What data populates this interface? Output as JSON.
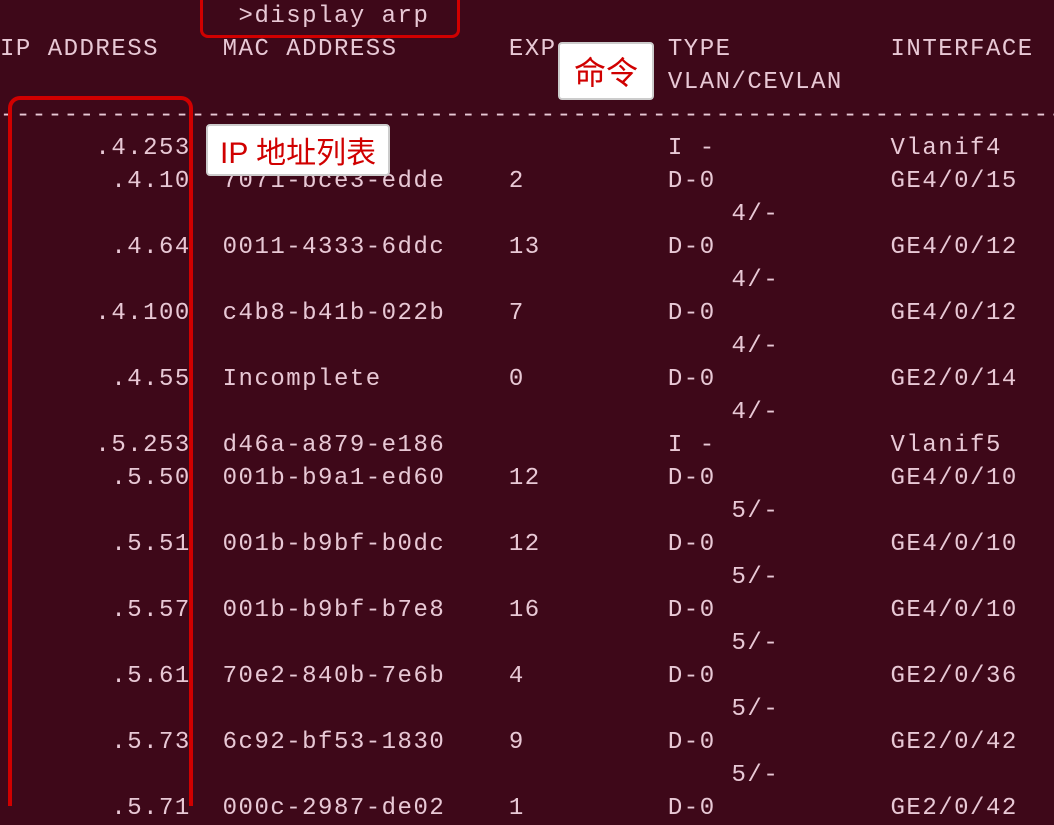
{
  "command": ">display arp",
  "headers": {
    "ip": "IP ADDRESS",
    "mac": "MAC ADDRESS",
    "exp": "EXP",
    "type": "TYPE",
    "iface": "INTERFACE",
    "sub": "VLAN/CEVLAN"
  },
  "divider_line": "----------------------------------------------------------------------",
  "labels": {
    "ip_list": "IP 地址列表",
    "command": "命令"
  },
  "rows": [
    {
      "ip": ".4.253",
      "mac": "",
      "exp": "",
      "type": "I -",
      "vlan": "",
      "iface": "Vlanif4"
    },
    {
      "ip": ".4.10",
      "mac": "7071-bce3-edde",
      "exp": "2",
      "type": "D-0",
      "vlan": "4/-",
      "iface": "GE4/0/15"
    },
    {
      "ip": ".4.64",
      "mac": "0011-4333-6ddc",
      "exp": "13",
      "type": "D-0",
      "vlan": "4/-",
      "iface": "GE4/0/12"
    },
    {
      "ip": ".4.100",
      "mac": "c4b8-b41b-022b",
      "exp": "7",
      "type": "D-0",
      "vlan": "4/-",
      "iface": "GE4/0/12"
    },
    {
      "ip": ".4.55",
      "mac": "Incomplete",
      "exp": "0",
      "type": "D-0",
      "vlan": "4/-",
      "iface": "GE2/0/14"
    },
    {
      "ip": ".5.253",
      "mac": "d46a-a879-e186",
      "exp": "",
      "type": "I -",
      "vlan": "",
      "iface": "Vlanif5"
    },
    {
      "ip": ".5.50",
      "mac": "001b-b9a1-ed60",
      "exp": "12",
      "type": "D-0",
      "vlan": "5/-",
      "iface": "GE4/0/10"
    },
    {
      "ip": ".5.51",
      "mac": "001b-b9bf-b0dc",
      "exp": "12",
      "type": "D-0",
      "vlan": "5/-",
      "iface": "GE4/0/10"
    },
    {
      "ip": ".5.57",
      "mac": "001b-b9bf-b7e8",
      "exp": "16",
      "type": "D-0",
      "vlan": "5/-",
      "iface": "GE4/0/10"
    },
    {
      "ip": ".5.61",
      "mac": "70e2-840b-7e6b",
      "exp": "4",
      "type": "D-0",
      "vlan": "5/-",
      "iface": "GE2/0/36"
    },
    {
      "ip": ".5.73",
      "mac": "6c92-bf53-1830",
      "exp": "9",
      "type": "D-0",
      "vlan": "5/-",
      "iface": "GE2/0/42"
    },
    {
      "ip": ".5.71",
      "mac": "000c-2987-de02",
      "exp": "1",
      "type": "D-0",
      "vlan": "",
      "iface": "GE2/0/42"
    }
  ],
  "cols": {
    "ip": 0,
    "mac": 14,
    "exp": 32,
    "type": 42,
    "vlan": 46,
    "iface": 56
  }
}
